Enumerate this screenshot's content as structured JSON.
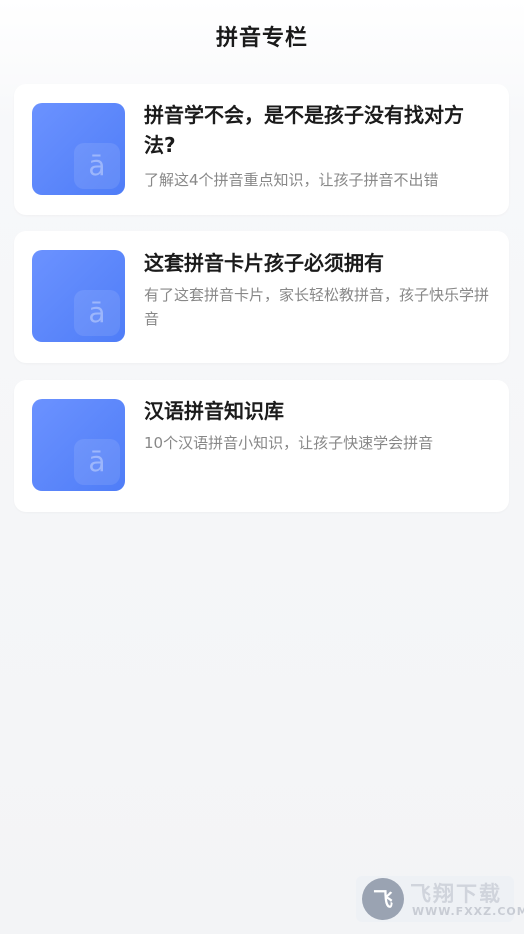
{
  "header": {
    "title": "拼音专栏"
  },
  "cards": [
    {
      "thumb_glyph": "ā",
      "thumb_icon": "pinyin-a-icon",
      "title": "拼音学不会，是不是孩子没有找对方法?",
      "desc": "了解这4个拼音重点知识，让孩子拼音不出错"
    },
    {
      "thumb_glyph": "ā",
      "thumb_icon": "pinyin-a-icon",
      "title": "这套拼音卡片孩子必须拥有",
      "desc": "有了这套拼音卡片，家长轻松教拼音，孩子快乐学拼音"
    },
    {
      "thumb_glyph": "ā",
      "thumb_icon": "pinyin-a-icon",
      "title": "汉语拼音知识库",
      "desc": "10个汉语拼音小知识，让孩子快速学会拼音"
    }
  ],
  "watermark": {
    "logo_text": "飞",
    "name": "飞翔下载",
    "url": "WWW.FXXZ.COM"
  },
  "colors": {
    "thumb": "#5a86f8",
    "title": "#1b1b1b",
    "desc": "#888888",
    "background": "#f3f4f6"
  }
}
